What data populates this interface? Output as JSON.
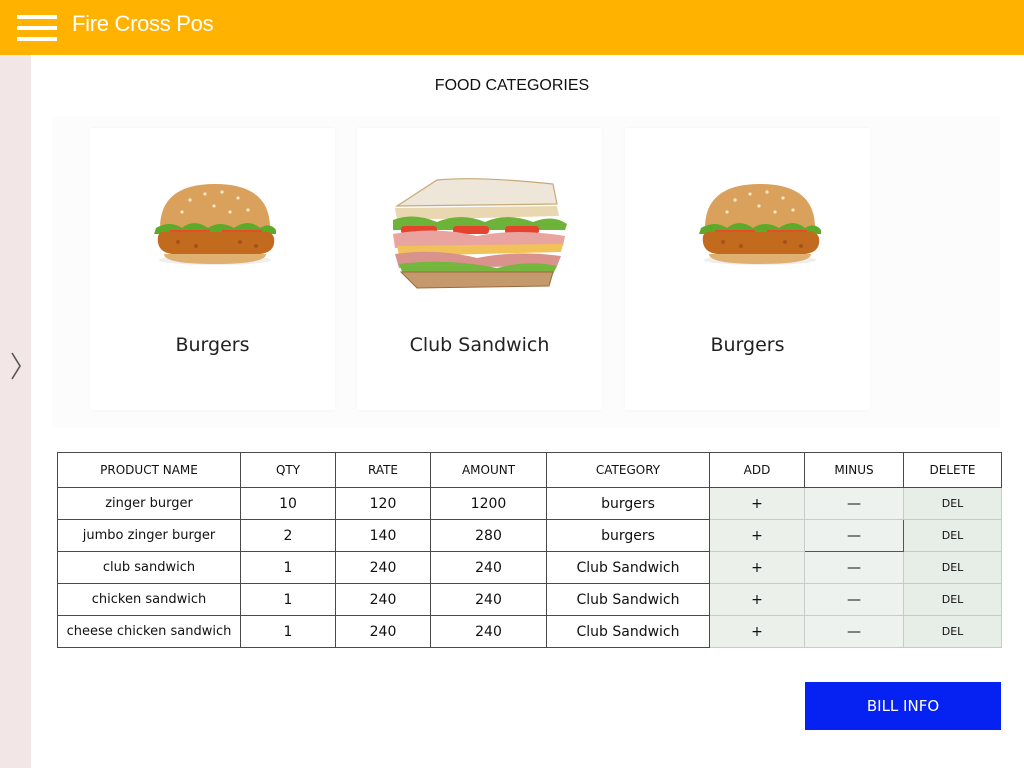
{
  "header": {
    "title": "Fire Cross Pos",
    "menu_icon": "hamburger-menu-icon",
    "accent_color": "#FFB300"
  },
  "sidebar": {
    "toggle_icon": "chevron-right-icon",
    "background": "#F2E6E6"
  },
  "categories": {
    "title": "FOOD CATEGORIES",
    "items": [
      {
        "label": "Burgers",
        "image": "burger-image"
      },
      {
        "label": "Club Sandwich",
        "image": "sandwich-image"
      },
      {
        "label": "Burgers",
        "image": "burger-image"
      }
    ]
  },
  "order_table": {
    "columns": [
      "PRODUCT NAME",
      "QTY",
      "RATE",
      "AMOUNT",
      "CATEGORY",
      "ADD",
      "MINUS",
      "DELETE"
    ],
    "rows": [
      {
        "name": "zinger burger",
        "qty": "10",
        "rate": "120",
        "amount": "1200",
        "category": "burgers",
        "add": "+",
        "minus": "—",
        "del": "DEL"
      },
      {
        "name": "jumbo zinger burger",
        "qty": "2",
        "rate": "140",
        "amount": "280",
        "category": "burgers",
        "add": "+",
        "minus": "—",
        "del": "DEL"
      },
      {
        "name": "club sandwich",
        "qty": "1",
        "rate": "240",
        "amount": "240",
        "category": "Club Sandwich",
        "add": "+",
        "minus": "—",
        "del": "DEL"
      },
      {
        "name": "chicken sandwich",
        "qty": "1",
        "rate": "240",
        "amount": "240",
        "category": "Club Sandwich",
        "add": "+",
        "minus": "—",
        "del": "DEL"
      },
      {
        "name": "cheese chicken sandwich",
        "qty": "1",
        "rate": "240",
        "amount": "240",
        "category": "Club Sandwich",
        "add": "+",
        "minus": "—",
        "del": "DEL"
      }
    ]
  },
  "bill_button": {
    "label": "BILL INFO",
    "color": "#0622F2"
  }
}
